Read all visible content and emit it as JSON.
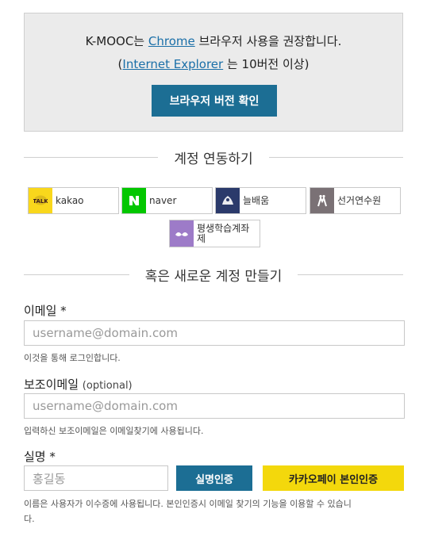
{
  "notice": {
    "line1_prefix": "K-MOOC는 ",
    "line1_link": "Chrome",
    "line1_suffix": " 브라우저 사용을 권장합니다.",
    "line2_open": "(",
    "line2_link": "Internet Explorer",
    "line2_suffix": " 는 10버전 이상)",
    "button": "브라우저 버전 확인"
  },
  "link_section": {
    "title": "계정 연동하기"
  },
  "social": [
    {
      "label": "kakao",
      "icon": "kakao-icon",
      "color": "#f9d71c"
    },
    {
      "label": "naver",
      "icon": "naver-icon",
      "color": "#03c700"
    },
    {
      "label": "늘배움",
      "icon": "neulbaeum-icon",
      "color": "#2b3a6b"
    },
    {
      "label": "선거연수원",
      "icon": "election-icon",
      "color": "#7a7175"
    },
    {
      "label": "평생학습계좌제",
      "icon": "lifelong-icon",
      "color": "#9d7bc8"
    }
  ],
  "new_section": {
    "title": "혹은 새로운 계정 만들기"
  },
  "email": {
    "label": "이메일 *",
    "placeholder": "username@domain.com",
    "hint": "이것을 통해 로그인합니다."
  },
  "sub_email": {
    "label": "보조이메일",
    "optional": "(optional)",
    "placeholder": "username@domain.com",
    "hint": "입력하신 보조이메일은 이메일찾기에 사용됩니다."
  },
  "name": {
    "label": "실명 *",
    "placeholder": "홍길동",
    "verify_button": "실명인증",
    "kakaopay_button": "카카오페이 본인인증",
    "hint_line1": "이름은 사용자가 이수증에 사용됩니다. 본인인증시 이메일 찾기의 기능을 이용할 수 있습니",
    "hint_line2": "다."
  },
  "colors": {
    "primary_button": "#1c6e94",
    "kakaopay_yellow": "#f3d80c",
    "link": "#1a6fa8"
  }
}
